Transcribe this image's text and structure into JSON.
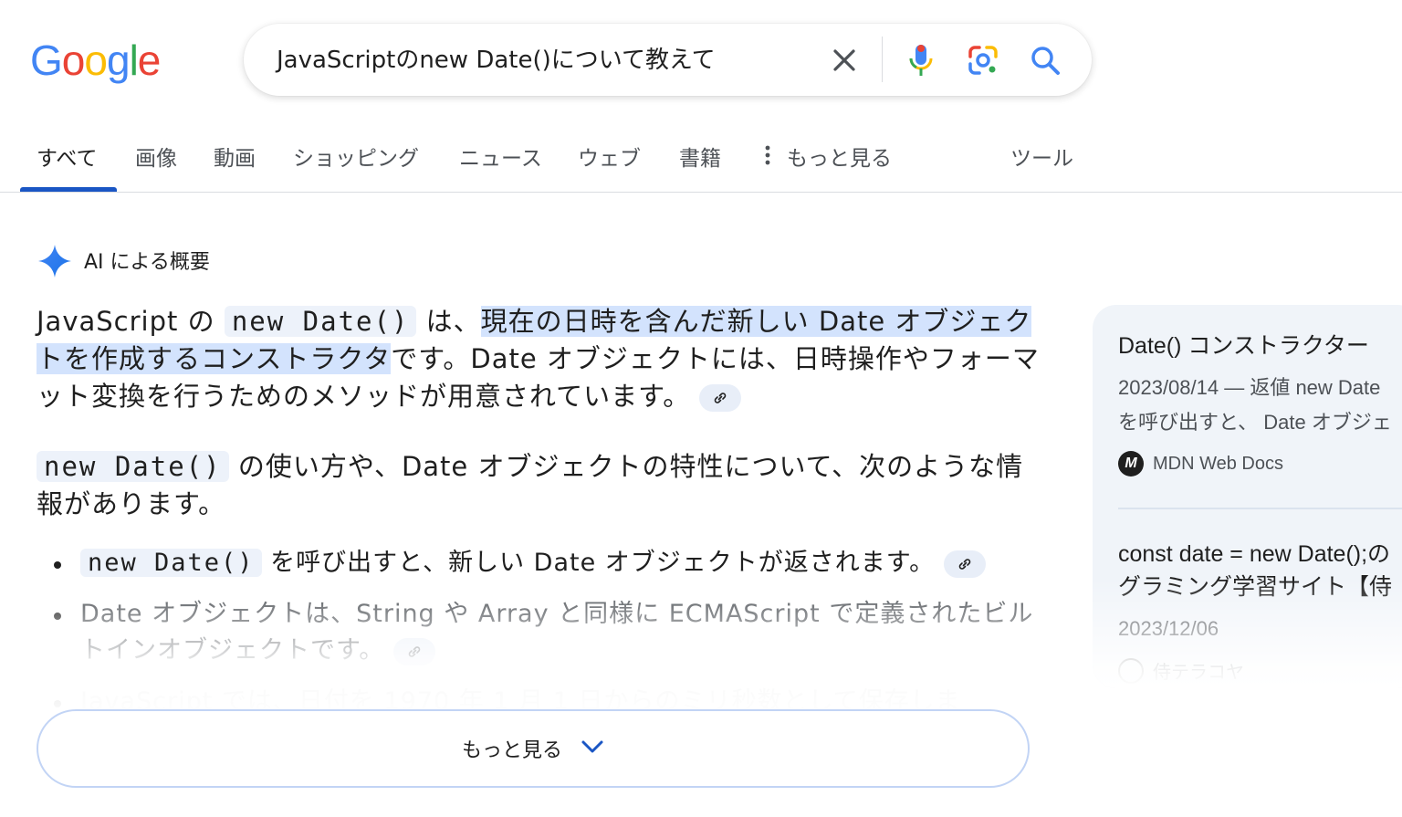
{
  "logo": {
    "text": "Google",
    "letters": [
      "G",
      "o",
      "o",
      "g",
      "l",
      "e"
    ],
    "colors": [
      "#4285F4",
      "#EA4335",
      "#FBBC05",
      "#4285F4",
      "#34A853",
      "#EA4335"
    ]
  },
  "search": {
    "query": "JavaScriptのnew Date()について教えて",
    "icons": [
      "close-icon",
      "microphone-icon",
      "lens-camera-icon",
      "search-icon"
    ]
  },
  "tabs": {
    "items": [
      {
        "label": "すべて",
        "active": true
      },
      {
        "label": "画像"
      },
      {
        "label": "動画"
      },
      {
        "label": "ショッピング"
      },
      {
        "label": "ニュース"
      },
      {
        "label": "ウェブ"
      },
      {
        "label": "書籍"
      },
      {
        "label": "もっと見る"
      }
    ],
    "tools": "ツール"
  },
  "ai_overview": {
    "header": "AI による概要",
    "p1": {
      "t1": "JavaScript の ",
      "code": "new Date()",
      "t2": " は、",
      "highlight": "現在の日時を含んだ新しい Date オブジェクトを作成するコンストラクタ",
      "t3": "です。Date オブジェクトには、日時操作やフォーマット変換を行うためのメソッドが用意されています。"
    },
    "p2": {
      "code": "new Date()",
      "t1": " の使い方や、Date オブジェクトの特性について、次のような情報があります。"
    },
    "bullets": [
      {
        "code": "new Date()",
        "text": " を呼び出すと、新しい Date オブジェクトが返されます。"
      },
      {
        "text": "Date オブジェクトは、String や Array と同様に ECMAScript で定義されたビルトインオブジェクトです。"
      },
      {
        "text": "JavaScript では、日付を 1970 年 1 月 1 日からのミリ秒数として保存しま"
      }
    ],
    "more_button": "もっと見る"
  },
  "side_panel": {
    "cards": [
      {
        "title": "Date() コンストラクター",
        "snippet_line1": "2023/08/14 — 返値 new Date",
        "snippet_line2": "を呼び出すと、 Date オブジェ",
        "source": "MDN Web Docs",
        "source_icon": "M"
      },
      {
        "title_line1": "const date = new Date();の",
        "title_line2": "グラミング学習サイト【侍",
        "date": "2023/12/06",
        "source": "侍テラコヤ"
      }
    ]
  },
  "colors": {
    "accent": "#1a56c4",
    "highlight": "#d3e3fd",
    "code_bg": "#edf2fa",
    "panel_bg": "#f0f4f9"
  }
}
